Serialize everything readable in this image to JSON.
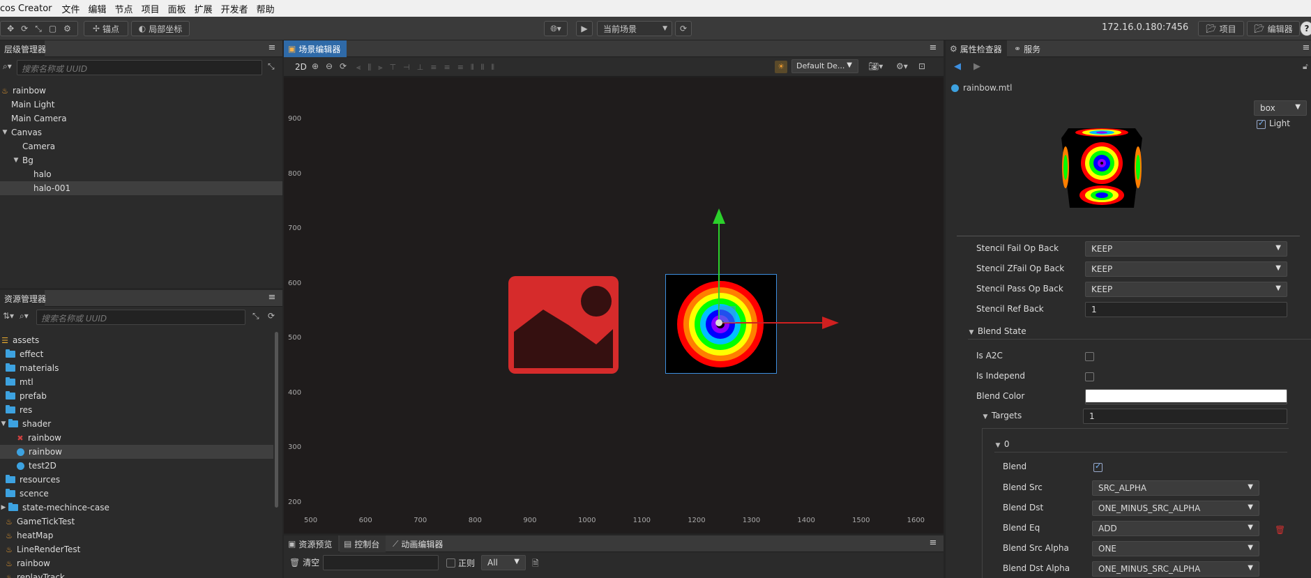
{
  "menubar": {
    "app_title": "cos Creator",
    "items": [
      "文件",
      "编辑",
      "节点",
      "项目",
      "面板",
      "扩展",
      "开发者",
      "帮助"
    ]
  },
  "toolbar": {
    "pivot_label": "锚点",
    "local_label": "局部坐标",
    "scene_select": "当前场景",
    "ip": "172.16.0.180:7456",
    "project_btn": "项目",
    "editor_btn": "编辑器",
    "help_icon": "?"
  },
  "hierarchy": {
    "title": "层级管理器",
    "search_placeholder": "搜索名称或 UUID",
    "nodes": [
      {
        "label": "rainbow",
        "depth": 0,
        "icon": "fire-icon"
      },
      {
        "label": "Main Light",
        "depth": 1
      },
      {
        "label": "Main Camera",
        "depth": 1
      },
      {
        "label": "Canvas",
        "depth": 1,
        "caret": "▼"
      },
      {
        "label": "Camera",
        "depth": 2
      },
      {
        "label": "Bg",
        "depth": 2,
        "caret": "▼"
      },
      {
        "label": "halo",
        "depth": 3
      },
      {
        "label": "halo-001",
        "depth": 3,
        "selected": true
      }
    ]
  },
  "assets": {
    "title": "资源管理器",
    "search_placeholder": "搜索名称或 UUID",
    "items": [
      {
        "label": "assets",
        "depth": 0,
        "icon": "db-icon"
      },
      {
        "label": "effect",
        "depth": 1,
        "icon": "folder-icon"
      },
      {
        "label": "materials",
        "depth": 1,
        "icon": "folder-icon"
      },
      {
        "label": "mtl",
        "depth": 1,
        "icon": "folder-icon"
      },
      {
        "label": "prefab",
        "depth": 1,
        "icon": "folder-icon"
      },
      {
        "label": "res",
        "depth": 1,
        "icon": "folder-icon"
      },
      {
        "label": "shader",
        "depth": 1,
        "icon": "folder-icon",
        "caret": "▼"
      },
      {
        "label": "rainbow",
        "depth": 2,
        "icon": "effect-icon"
      },
      {
        "label": "rainbow",
        "depth": 2,
        "icon": "material-icon",
        "selected": true
      },
      {
        "label": "test2D",
        "depth": 2,
        "icon": "material-icon"
      },
      {
        "label": "resources",
        "depth": 1,
        "icon": "folder-icon"
      },
      {
        "label": "scence",
        "depth": 1,
        "icon": "folder-icon"
      },
      {
        "label": "state-mechince-case",
        "depth": 1,
        "icon": "folder-icon",
        "caret": "▶"
      },
      {
        "label": "GameTickTest",
        "depth": 1,
        "icon": "fire-icon"
      },
      {
        "label": "heatMap",
        "depth": 1,
        "icon": "fire-icon"
      },
      {
        "label": "LineRenderTest",
        "depth": 1,
        "icon": "fire-icon"
      },
      {
        "label": "rainbow",
        "depth": 1,
        "icon": "fire-icon"
      },
      {
        "label": "replayTrack",
        "depth": 1,
        "icon": "fire-icon"
      }
    ]
  },
  "scene": {
    "title": "场景编辑器",
    "mode_2d": "2D",
    "layer_select": "Default De...",
    "y_ticks": [
      "900",
      "800",
      "700",
      "600",
      "500",
      "400",
      "300",
      "200"
    ],
    "x_ticks": [
      "500",
      "600",
      "700",
      "800",
      "900",
      "1000",
      "1100",
      "1200",
      "1300",
      "1400",
      "1500",
      "1600"
    ]
  },
  "console": {
    "tabs": [
      "资源预览",
      "控制台",
      "动画编辑器"
    ],
    "clear_label": "清空",
    "regex_label": "正则",
    "level_select": "All"
  },
  "inspector": {
    "tabs": [
      "属性检查器",
      "服务"
    ],
    "file_name": "rainbow.mtl",
    "preview_shape": "box",
    "light_label": "Light",
    "properties": [
      {
        "label": "Stencil Fail Op Back",
        "type": "select",
        "value": "KEEP"
      },
      {
        "label": "Stencil ZFail Op Back",
        "type": "select",
        "value": "KEEP"
      },
      {
        "label": "Stencil Pass Op Back",
        "type": "select",
        "value": "KEEP"
      },
      {
        "label": "Stencil Ref Back",
        "type": "input",
        "value": "1"
      }
    ],
    "blend_state_label": "Blend State",
    "is_a2c_label": "Is A2C",
    "is_independ_label": "Is Independ",
    "blend_color_label": "Blend Color",
    "blend_color_value": "#ffffff",
    "targets_label": "Targets",
    "targets_value": "1",
    "target_index": "0",
    "blend_label": "Blend",
    "target_props": [
      {
        "label": "Blend Src",
        "value": "SRC_ALPHA"
      },
      {
        "label": "Blend Dst",
        "value": "ONE_MINUS_SRC_ALPHA"
      },
      {
        "label": "Blend Eq",
        "value": "ADD"
      },
      {
        "label": "Blend Src Alpha",
        "value": "ONE"
      },
      {
        "label": "Blend Dst Alpha",
        "value": "ONE_MINUS_SRC_ALPHA"
      }
    ]
  }
}
